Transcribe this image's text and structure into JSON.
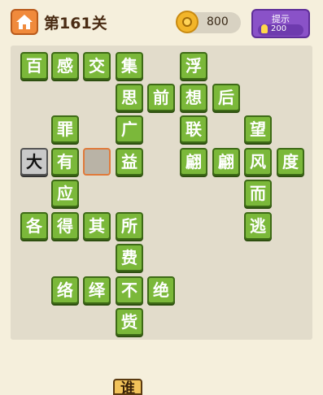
{
  "header": {
    "level_title": "第161关",
    "coins": "800",
    "hint_label": "提示",
    "hint_cost": "200"
  },
  "colors": {
    "tile_green": "#7bb83a",
    "home_orange": "#f08a3c",
    "hint_purple": "#8a52c8",
    "empty_cell_border": "#e07a3a"
  },
  "board": {
    "row1": [
      "百",
      "感",
      "交",
      "集",
      "浮"
    ],
    "row2": [
      "思",
      "前",
      "想",
      "后"
    ],
    "row3": [
      "罪",
      "广",
      "联",
      "望"
    ],
    "row4": [
      "大",
      "有",
      "",
      "益",
      "翩",
      "翩",
      "风",
      "度"
    ],
    "row5": [
      "应",
      "而"
    ],
    "row6": [
      "各",
      "得",
      "其",
      "所",
      "逃"
    ],
    "row7": [
      "费"
    ],
    "row8": [
      "络",
      "绎",
      "不",
      "绝"
    ],
    "row9": [
      "赀"
    ]
  },
  "candidates": [
    "谁"
  ]
}
